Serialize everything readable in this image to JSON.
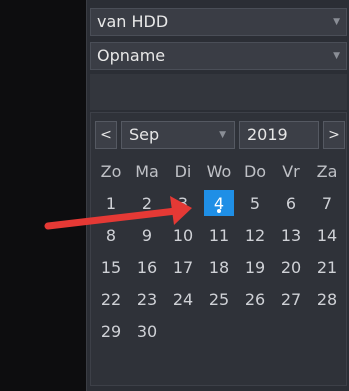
{
  "filters": {
    "source": "van HDD",
    "type": "Opname"
  },
  "calendar": {
    "prev_label": "<",
    "next_label": ">",
    "month": "Sep",
    "year": "2019",
    "weekdays": [
      "Zo",
      "Ma",
      "Di",
      "Wo",
      "Do",
      "Vr",
      "Za"
    ],
    "days": [
      "",
      "1",
      "2",
      "3",
      "4",
      "5",
      "6",
      "7",
      "8",
      "9",
      "10",
      "11",
      "12",
      "13",
      "14",
      "15",
      "16",
      "17",
      "18",
      "19",
      "20",
      "21",
      "22",
      "23",
      "24",
      "25",
      "26",
      "27",
      "28",
      "29",
      "30"
    ],
    "selected_day": "4"
  },
  "colors": {
    "selected": "#1f8fe6",
    "annotation_arrow": "#e53935"
  }
}
